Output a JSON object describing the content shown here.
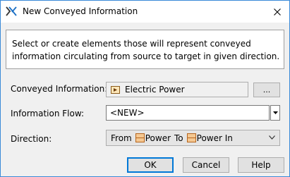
{
  "window": {
    "title": "New Conveyed Information",
    "app_icon": "magicdraw-logo-icon",
    "close_icon": "close-icon"
  },
  "description": "Select or create elements those will represent conveyed information circulating from source to target in given direction.",
  "conveyed": {
    "label": "Conveyed Information:",
    "value": "Electric Power",
    "value_icon": "signal-icon",
    "browse_label": "..."
  },
  "flow": {
    "label": "Information Flow:",
    "value": "<NEW>"
  },
  "direction": {
    "label": "Direction:",
    "from_word": "From",
    "from_port": "Power",
    "to_word": "To",
    "to_port": "Power In",
    "port_icon": "port-icon"
  },
  "buttons": {
    "ok": "OK",
    "cancel": "Cancel",
    "help": "Help"
  },
  "colors": {
    "accent": "#0078d7",
    "port_icon_fill": "#f5c892",
    "port_icon_stroke": "#b5651d",
    "window_border": "#3a8ad8"
  }
}
